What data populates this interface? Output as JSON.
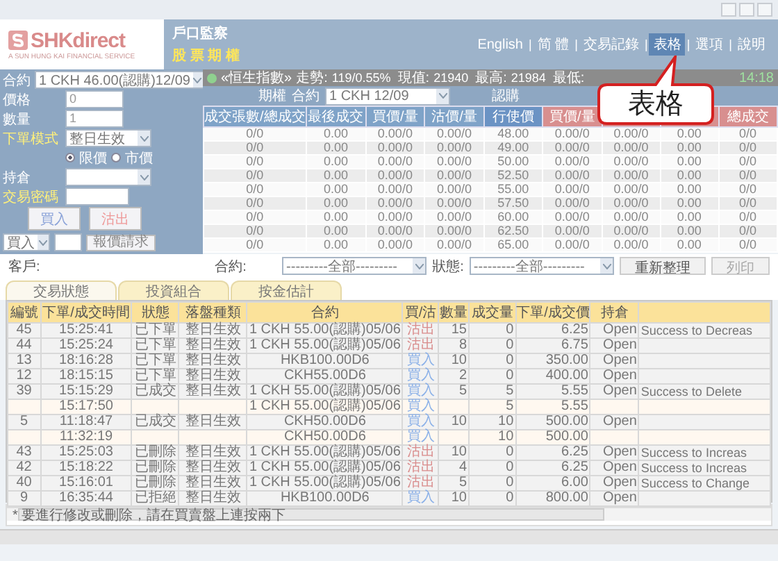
{
  "header": {
    "logo": "SHKdirect",
    "logo_tagline": "A SUN HUNG KAI FINANCIAL SERVICE",
    "section_title": "戶口監察",
    "product": "股 票 期 權",
    "nav_separator": "|",
    "nav": [
      {
        "label": "English",
        "selected": false
      },
      {
        "label": "简 體",
        "selected": false
      },
      {
        "label": "交易記錄",
        "selected": false
      },
      {
        "label": "表格",
        "selected": true
      },
      {
        "label": "選項",
        "selected": false
      },
      {
        "label": "說明",
        "selected": false
      }
    ]
  },
  "order_form": {
    "fields": [
      {
        "kind": "select",
        "label": "合約",
        "value": "1 CKH 46.00(認購)12/09"
      },
      {
        "kind": "input",
        "label": "價格",
        "value": "0"
      },
      {
        "kind": "input",
        "label": "數量",
        "value": "1"
      },
      {
        "kind": "select",
        "label": "下單模式",
        "value": "整日生效"
      }
    ],
    "price_type": [
      {
        "label": "限價",
        "selected": true
      },
      {
        "label": "市價",
        "selected": false
      }
    ],
    "fields2": [
      {
        "kind": "select",
        "label": "持倉"
      },
      {
        "kind": "input",
        "label": "交易密碼"
      }
    ],
    "buy_button": "買入",
    "sell_button": "沽出",
    "side_select": "買入",
    "quote_button": "報價請求"
  },
  "ticker": {
    "index": "«恒生指數»",
    "items": [
      {
        "label": "走勢:",
        "value": "119/0.55%"
      },
      {
        "label": "現值:",
        "value": "21940"
      },
      {
        "label": "最高:",
        "value": "21984"
      },
      {
        "label": "最低:"
      }
    ],
    "time": "14:18"
  },
  "chain": {
    "label": "期權",
    "contract_label": "合約",
    "contract": "1 CKH 12/09",
    "call_label": "認購",
    "columns": [
      {
        "label": "成交張數/總成交",
        "kind": "call"
      },
      {
        "label": "最後成交",
        "kind": "call"
      },
      {
        "label": "買價/量",
        "kind": "call"
      },
      {
        "label": "沽價/量",
        "kind": "call"
      },
      {
        "label": "行使價",
        "kind": "strike"
      },
      {
        "label": "買價/量",
        "kind": "put"
      },
      {
        "kind": "put"
      },
      {
        "kind": "put"
      },
      {
        "label": "總成交",
        "kind": "put"
      }
    ],
    "rows": [
      [
        "0/0",
        "0.00",
        "0.00/0",
        "0.00/0",
        "48.00",
        "0.00/0",
        "0.00/0",
        "0.00",
        "0/0"
      ],
      [
        "0/0",
        "0.00",
        "0.00/0",
        "0.00/0",
        "49.00",
        "0.00/0",
        "0.00/0",
        "0.00",
        "0/0"
      ],
      [
        "0/0",
        "0.00",
        "0.00/0",
        "0.00/0",
        "50.00",
        "0.00/0",
        "0.00/0",
        "0.00",
        "0/0"
      ],
      [
        "0/0",
        "0.00",
        "0.00/0",
        "0.00/0",
        "52.50",
        "0.00/0",
        "0.00/0",
        "0.00",
        "0/0"
      ],
      [
        "0/0",
        "0.00",
        "0.00/0",
        "0.00/0",
        "55.00",
        "0.00/0",
        "0.00/0",
        "0.00",
        "0/0"
      ],
      [
        "0/0",
        "0.00",
        "0.00/0",
        "0.00/0",
        "57.50",
        "0.00/0",
        "0.00/0",
        "0.00",
        "0/0"
      ],
      [
        "0/0",
        "0.00",
        "0.00/0",
        "0.00/0",
        "60.00",
        "0.00/0",
        "0.00/0",
        "0.00",
        "0/0"
      ],
      [
        "0/0",
        "0.00",
        "0.00/0",
        "0.00/0",
        "62.50",
        "0.00/0",
        "0.00/0",
        "0.00",
        "0/0"
      ],
      [
        "0/0",
        "0.00",
        "0.00/0",
        "0.00/0",
        "65.00",
        "0.00/0",
        "0.00/0",
        "0.00",
        "0/0"
      ]
    ]
  },
  "callout": {
    "text": "表格"
  },
  "filters": {
    "client_label": "客戶:",
    "contract_label": "合約:",
    "contract_value": "---------全部---------",
    "status_label": "狀態:",
    "status_value": "---------全部---------",
    "refresh_button": "重新整理",
    "print_button": {
      "label": "列印",
      "disabled": true
    }
  },
  "tabs": [
    {
      "label": "交易狀態",
      "selected": true
    },
    {
      "label": "投資組合",
      "selected": false
    },
    {
      "label": "按金估計",
      "selected": false
    }
  ],
  "orders": {
    "columns": [
      "編號",
      "下單/成交時間",
      "狀態",
      "落盤種類",
      "合約",
      "買/沽",
      "數量",
      "成交量",
      "下單/成交價",
      "持倉"
    ],
    "rows": [
      {
        "kind": "order",
        "no": "45",
        "time": "15:25:41",
        "status": "已下單",
        "type": "整日生效",
        "contract": "1 CKH 55.00(認購)05/06",
        "side": "沽出",
        "sell": true,
        "qty": "15",
        "filled": "0",
        "price": "6.25",
        "position": "Open",
        "message": "Success to Decreas"
      },
      {
        "kind": "order",
        "no": "44",
        "time": "15:25:24",
        "status": "已下單",
        "type": "整日生效",
        "contract": "1 CKH 55.00(認購)05/06",
        "side": "沽出",
        "sell": true,
        "qty": "8",
        "filled": "0",
        "price": "6.75",
        "position": "Open"
      },
      {
        "kind": "order",
        "no": "13",
        "time": "18:16:28",
        "status": "已下單",
        "type": "整日生效",
        "contract": "HKB100.00D6",
        "side": "買入",
        "sell": false,
        "qty": "10",
        "filled": "0",
        "price": "350.00",
        "position": "Open"
      },
      {
        "kind": "order",
        "no": "12",
        "time": "18:15:15",
        "status": "已下單",
        "type": "整日生效",
        "contract": "CKH55.00D6",
        "side": "買入",
        "sell": false,
        "qty": "2",
        "filled": "0",
        "price": "400.00",
        "position": "Open"
      },
      {
        "kind": "order",
        "no": "39",
        "time": "15:15:29",
        "status": "已成交",
        "type": "整日生效",
        "contract": "1 CKH 55.00(認購)05/06",
        "side": "買入",
        "sell": false,
        "qty": "5",
        "filled": "5",
        "price": "5.55",
        "position": "Open",
        "message": "Success to Delete"
      },
      {
        "kind": "fill",
        "time": "15:17:50",
        "contract": "1 CKH 55.00(認購)05/06",
        "side": "買入",
        "sell": false,
        "filled": "5",
        "price": "5.55"
      },
      {
        "kind": "order",
        "no": "5",
        "time": "11:18:47",
        "status": "已成交",
        "type": "整日生效",
        "contract": "CKH50.00D6",
        "side": "買入",
        "sell": false,
        "qty": "10",
        "filled": "10",
        "price": "500.00",
        "position": "Open"
      },
      {
        "kind": "fill",
        "time": "11:32:19",
        "contract": "CKH50.00D6",
        "side": "買入",
        "sell": false,
        "filled": "10",
        "price": "500.00"
      },
      {
        "kind": "order",
        "no": "43",
        "time": "15:25:03",
        "status": "已刪除",
        "type": "整日生效",
        "contract": "1 CKH 55.00(認購)05/06",
        "side": "沽出",
        "sell": true,
        "qty": "10",
        "filled": "0",
        "price": "6.25",
        "position": "Open",
        "message": "Success to Increas"
      },
      {
        "kind": "order",
        "no": "42",
        "time": "15:18:22",
        "status": "已刪除",
        "type": "整日生效",
        "contract": "1 CKH 55.00(認購)05/06",
        "side": "沽出",
        "sell": true,
        "qty": "4",
        "filled": "0",
        "price": "6.25",
        "position": "Open",
        "message": "Success to Increas"
      },
      {
        "kind": "order",
        "no": "40",
        "time": "15:16:01",
        "status": "已刪除",
        "type": "整日生效",
        "contract": "1 CKH 55.00(認購)05/06",
        "side": "沽出",
        "sell": true,
        "qty": "5",
        "filled": "0",
        "price": "6.00",
        "position": "Open",
        "message": "Success to Change"
      },
      {
        "kind": "order",
        "no": "9",
        "time": "16:35:44",
        "status": "已拒絕",
        "type": "整日生效",
        "contract": "HKB100.00D6",
        "side": "買入",
        "sell": false,
        "qty": "10",
        "filled": "0",
        "price": "800.00",
        "position": "Open"
      }
    ]
  },
  "note": "*  要進行修改或刪除，請在買賣盤上連按兩下"
}
